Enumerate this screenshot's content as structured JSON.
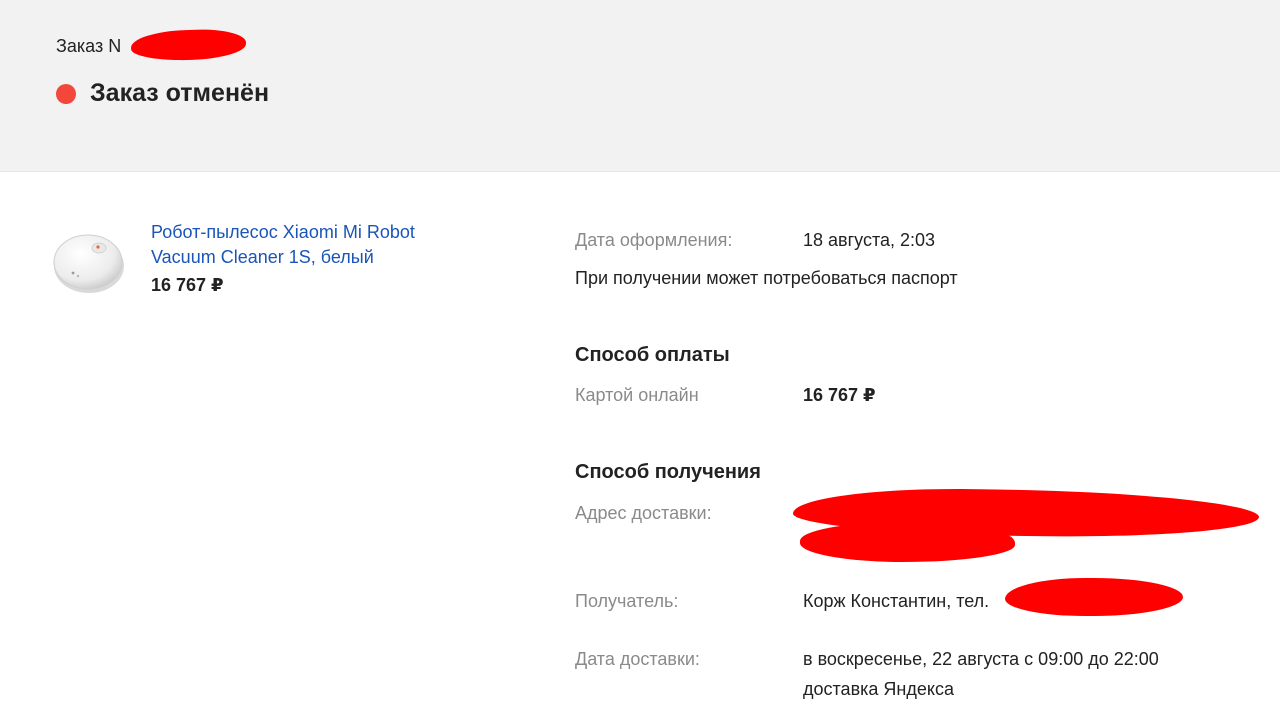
{
  "header": {
    "order_number_label": "Заказ N",
    "status_label": "Заказ отменён",
    "status_color": "#f2473a"
  },
  "product": {
    "image_icon": "robot-vacuum-icon",
    "title": "Робот-пылесос Xiaomi Mi Robot Vacuum Cleaner 1S, белый",
    "price": "16 767 ₽",
    "link_color": "#1a55b8"
  },
  "details": {
    "order_date_label": "Дата оформления:",
    "order_date_value": "18 августа, 2:03",
    "passport_note": "При получении может потребоваться паспорт",
    "payment": {
      "title": "Способ оплаты",
      "method_label": "Картой онлайн",
      "amount": "16 767 ₽"
    },
    "delivery": {
      "title": "Способ получения",
      "address_label": "Адрес доставки:",
      "recipient_label": "Получатель:",
      "recipient_value": "Корж Константин, тел.",
      "date_label": "Дата доставки:",
      "date_value_line1": "в воскресенье, 22 августа с 09:00 до 22:00",
      "date_value_line2": "доставка Яндекса"
    }
  }
}
